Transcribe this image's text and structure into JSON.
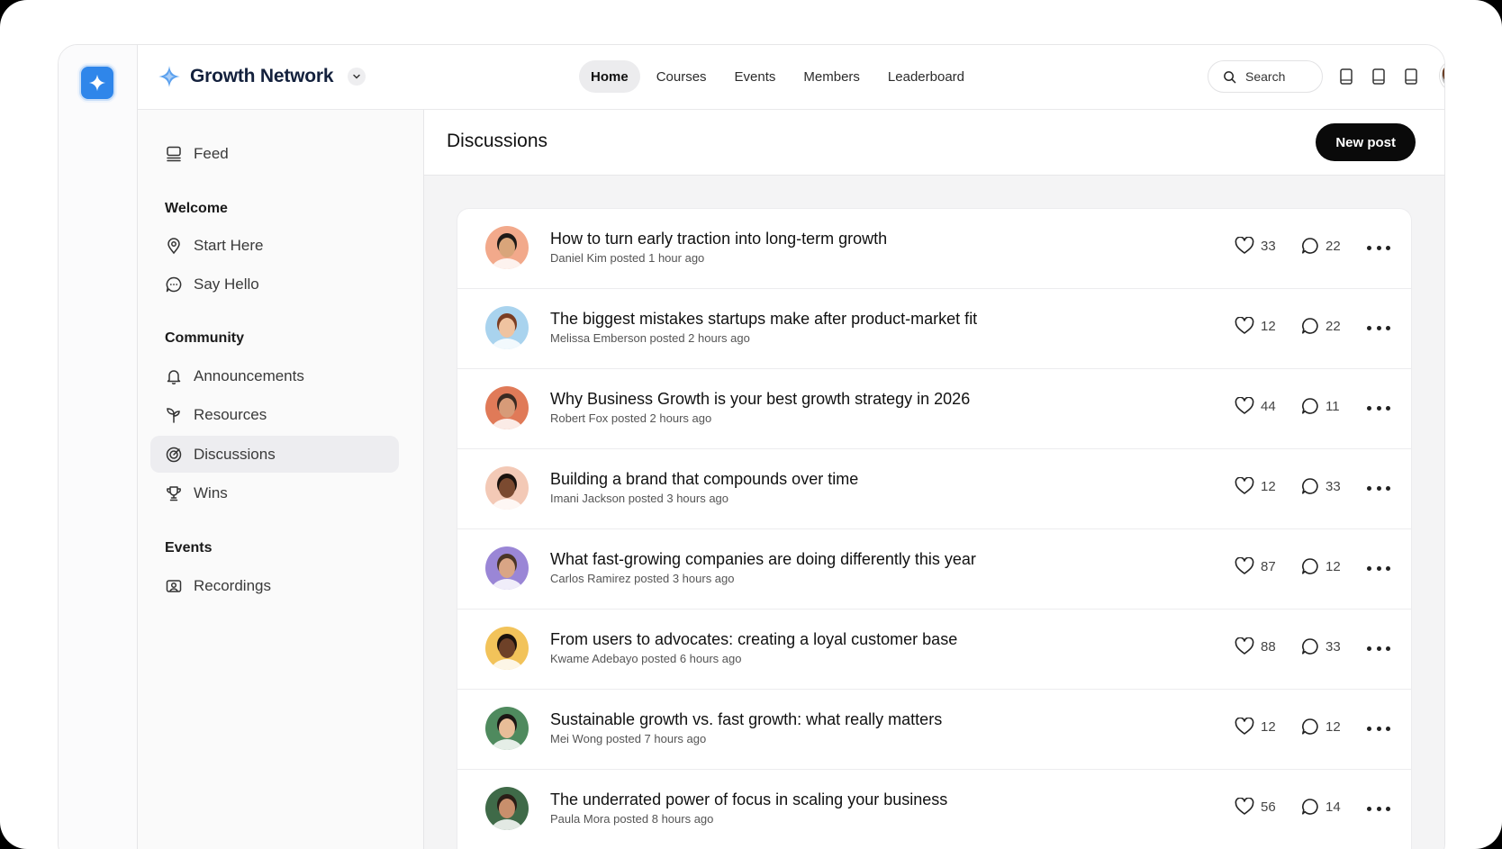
{
  "brand": {
    "name": "Growth Network"
  },
  "nav": {
    "tabs": [
      "Home",
      "Courses",
      "Events",
      "Members",
      "Leaderboard"
    ],
    "active": "Home"
  },
  "search": {
    "label": "Search"
  },
  "sidebar": {
    "feed": "Feed",
    "sections": [
      {
        "heading": "Welcome",
        "items": [
          "Start Here",
          "Say Hello"
        ]
      },
      {
        "heading": "Community",
        "items": [
          "Announcements",
          "Resources",
          "Discussions",
          "Wins"
        ]
      },
      {
        "heading": "Events",
        "items": [
          "Recordings"
        ]
      }
    ],
    "active_item": "Discussions"
  },
  "main": {
    "title": "Discussions",
    "new_post_label": "New post"
  },
  "posts": [
    {
      "title": "How to turn early traction into long-term growth",
      "meta": "Daniel Kim posted 1 hour ago",
      "likes": "33",
      "comments": "22",
      "avatar_bg": "#f2a98b",
      "skin": "#d9a57a",
      "hair": "#1e1a18"
    },
    {
      "title": "The biggest mistakes startups make after product-market fit",
      "meta": "Melissa Emberson posted 2 hours ago",
      "likes": "12",
      "comments": "22",
      "avatar_bg": "#a9d3ee",
      "skin": "#efc3a0",
      "hair": "#7a3d22"
    },
    {
      "title": "Why Business Growth is your best growth strategy in 2026",
      "meta": "Robert Fox posted 2 hours ago",
      "likes": "44",
      "comments": "11",
      "avatar_bg": "#e07a58",
      "skin": "#d79b78",
      "hair": "#3a2a22"
    },
    {
      "title": "Building a brand that compounds over time",
      "meta": "Imani Jackson posted 3 hours ago",
      "likes": "12",
      "comments": "33",
      "avatar_bg": "#f3c9b6",
      "skin": "#7b4a30",
      "hair": "#1a120e"
    },
    {
      "title": "What fast-growing companies are doing differently this year",
      "meta": "Carlos Ramirez posted 3 hours ago",
      "likes": "87",
      "comments": "12",
      "avatar_bg": "#9a86d6",
      "skin": "#d9a585",
      "hair": "#4a3526"
    },
    {
      "title": "From users to advocates: creating a loyal customer base",
      "meta": "Kwame Adebayo posted 6 hours ago",
      "likes": "88",
      "comments": "33",
      "avatar_bg": "#f2c35a",
      "skin": "#6e4128",
      "hair": "#1a120e"
    },
    {
      "title": "Sustainable growth vs. fast growth: what really matters",
      "meta": "Mei Wong posted 7 hours ago",
      "likes": "12",
      "comments": "12",
      "avatar_bg": "#4f8a5e",
      "skin": "#e8bd98",
      "hair": "#1c1614"
    },
    {
      "title": "The underrated power of focus in scaling your business",
      "meta": "Paula Mora posted 8 hours ago",
      "likes": "56",
      "comments": "14",
      "avatar_bg": "#3f6a48",
      "skin": "#c88f6c",
      "hair": "#2a1d16"
    }
  ]
}
